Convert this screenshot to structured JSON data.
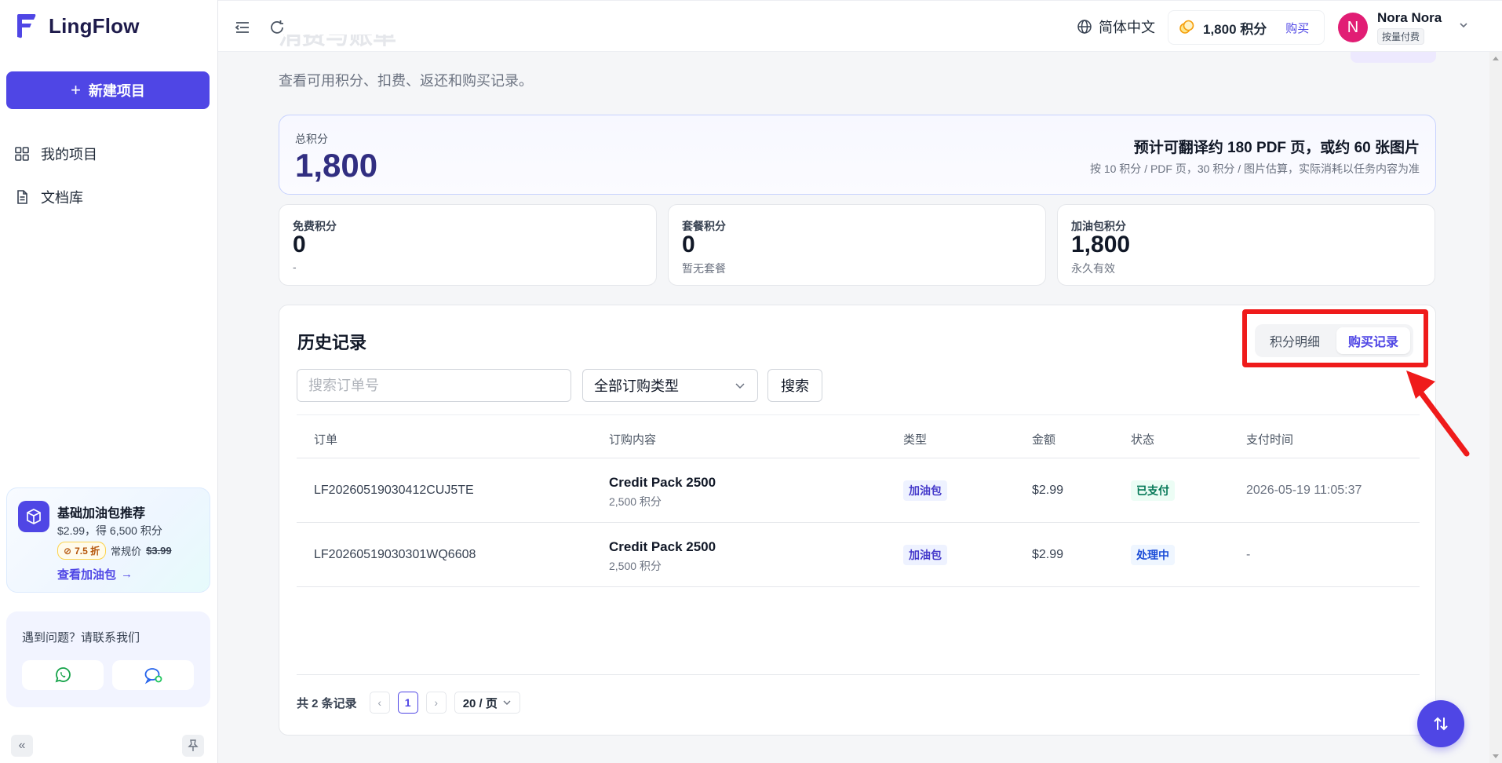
{
  "app": {
    "name": "LingFlow"
  },
  "sidebar": {
    "new_button": "新建项目",
    "items": [
      {
        "label": "我的项目",
        "icon": "grid-icon"
      },
      {
        "label": "文档库",
        "icon": "document-icon"
      }
    ],
    "promo": {
      "title": "基础加油包推荐",
      "subtitle": "$2.99，得 6,500 积分",
      "discount": "7.5 折",
      "regular_label": "常规价",
      "regular_price": "$3.99",
      "link": "查看加油包"
    },
    "help": {
      "text": "遇到问题？请联系我们"
    }
  },
  "topbar": {
    "language": "简体中文",
    "credits": "1,800 积分",
    "buy": "购买",
    "user": {
      "initial": "N",
      "name": "Nora Nora",
      "plan": "按量付费"
    }
  },
  "page": {
    "title": "消费与账单",
    "subtitle": "查看可用积分、扣费、返还和购买记录。"
  },
  "summary": {
    "total_label": "总积分",
    "total_value": "1,800",
    "estimate": "预计可翻译约 180 PDF 页，或约 60 张图片",
    "estimate_note": "按 10 积分 / PDF 页，30 积分 / 图片估算，实际消耗以任务内容为准",
    "cards": [
      {
        "label": "免费积分",
        "value": "0",
        "note": "-"
      },
      {
        "label": "套餐积分",
        "value": "0",
        "note": "暂无套餐"
      },
      {
        "label": "加油包积分",
        "value": "1,800",
        "note": "永久有效"
      }
    ]
  },
  "history": {
    "title": "历史记录",
    "tabs": [
      "积分明细",
      "购买记录"
    ],
    "active_tab": "购买记录",
    "search_placeholder": "搜索订单号",
    "type_filter": "全部订购类型",
    "search_button": "搜索",
    "columns": [
      "订单",
      "订购内容",
      "类型",
      "金额",
      "状态",
      "支付时间"
    ],
    "rows": [
      {
        "order": "LF20260519030412CUJ5TE",
        "product": "Credit Pack 2500",
        "product_sub": "2,500 积分",
        "type": "加油包",
        "amount": "$2.99",
        "status": "已支付",
        "time": "2026-05-19 11:05:37"
      },
      {
        "order": "LF20260519030301WQ6608",
        "product": "Credit Pack 2500",
        "product_sub": "2,500 积分",
        "type": "加油包",
        "amount": "$2.99",
        "status": "处理中",
        "time": "-"
      }
    ],
    "pagination": {
      "total": "共 2 条记录",
      "current_page": "1",
      "page_size": "20 / 页"
    }
  },
  "colors": {
    "accent": "#4f46e5",
    "annotation": "#ef1b1b"
  }
}
